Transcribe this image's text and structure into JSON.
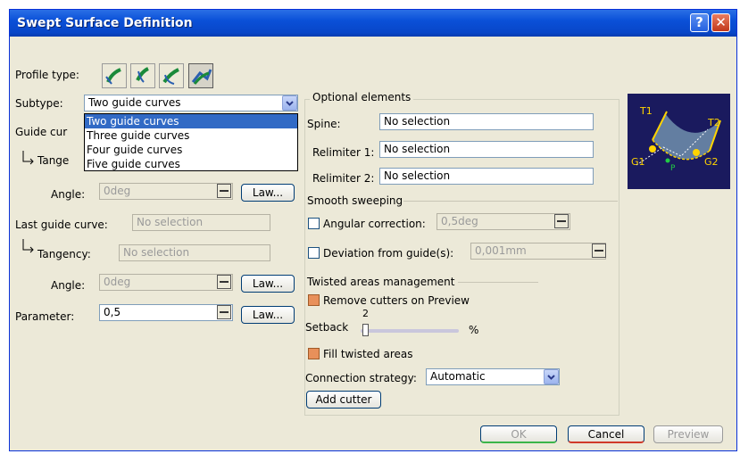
{
  "window": {
    "title": "Swept Surface Definition",
    "help_glyph": "?",
    "close_glyph": "✕"
  },
  "profile": {
    "label": "Profile type:",
    "icons": [
      "line-profile-icon",
      "circle-profile-icon",
      "conic-profile-icon",
      "explicit-profile-icon"
    ]
  },
  "subtype": {
    "label": "Subtype:",
    "value": "Two guide curves",
    "options": [
      "Two guide curves",
      "Three guide curves",
      "Four guide curves",
      "Five guide curves"
    ]
  },
  "first_guide": {
    "label_partial": "Guide cur",
    "tangency_partial": "Tange",
    "angle_label": "Angle:",
    "angle_value": "0deg",
    "law_label": "Law..."
  },
  "last_guide": {
    "label": "Last guide curve:",
    "value": "No selection",
    "tangency_label": "Tangency:",
    "tangency_value": "No selection",
    "angle_label": "Angle:",
    "angle_value": "0deg",
    "law_label": "Law..."
  },
  "parameter": {
    "label": "Parameter:",
    "value": "0,5",
    "law_label": "Law..."
  },
  "optional": {
    "title": "Optional elements",
    "spine_label": "Spine:",
    "spine_value": "No selection",
    "relimiter1_label": "Relimiter 1:",
    "relimiter1_value": "No selection",
    "relimiter2_label": "Relimiter 2:",
    "relimiter2_value": "No selection"
  },
  "smooth": {
    "title": "Smooth sweeping",
    "angular_label": "Angular correction:",
    "angular_value": "0,5deg",
    "deviation_label": "Deviation from guide(s):",
    "deviation_value": "0,001mm"
  },
  "twisted": {
    "title": "Twisted areas management",
    "remove_cutters_label": "Remove cutters on Preview",
    "remove_cutters_checked": true,
    "setback_label": "Setback",
    "setback_value": "2",
    "setback_unit": "%",
    "fill_label": "Fill twisted areas",
    "fill_checked": true,
    "connection_label": "Connection strategy:",
    "connection_value": "Automatic",
    "add_cutter_label": "Add cutter"
  },
  "preview_image": {
    "labels": [
      "T1",
      "T2",
      "G1",
      "G2",
      "P"
    ]
  },
  "footer": {
    "ok_label": "OK",
    "cancel_label": "Cancel",
    "preview_label": "Preview"
  }
}
